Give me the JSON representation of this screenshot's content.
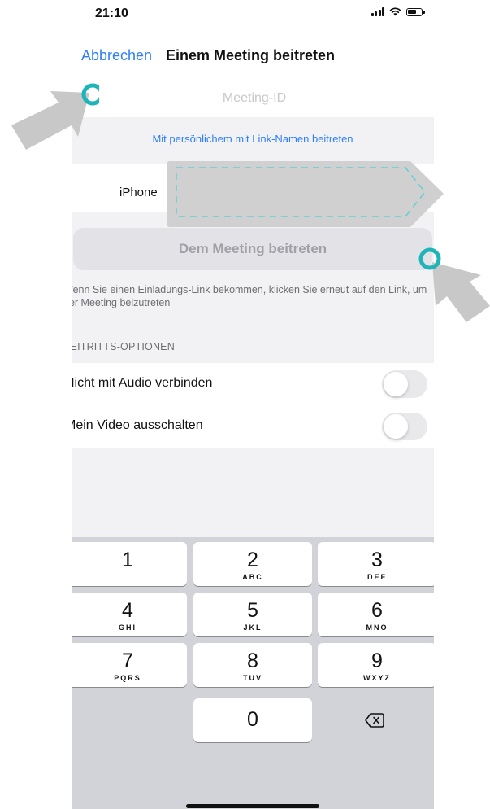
{
  "status_bar": {
    "time": "21:10"
  },
  "nav": {
    "cancel_label": "Abbrechen",
    "title": "Einem Meeting beitreten"
  },
  "meeting_id": {
    "placeholder": "Meeting-ID",
    "value": ""
  },
  "personal_link_label": "Mit persönlichem mit Link-Namen beitreten",
  "name_field": {
    "label": "iPhone",
    "value": ""
  },
  "join_button_label": "Dem Meeting beitreten",
  "hint": "Wenn Sie einen Einladungs-Link bekommen, klicken Sie erneut auf den Link, um der Meeting beizutreten",
  "join_options": {
    "header": "BEITRITTS-OPTIONEN",
    "items": [
      {
        "label": "Nicht mit Audio verbinden",
        "enabled": false
      },
      {
        "label": "Mein Video ausschalten",
        "enabled": false
      }
    ]
  },
  "keypad": {
    "keys": [
      {
        "digit": "1",
        "letters": ""
      },
      {
        "digit": "2",
        "letters": "ABC"
      },
      {
        "digit": "3",
        "letters": "DEF"
      },
      {
        "digit": "4",
        "letters": "GHI"
      },
      {
        "digit": "5",
        "letters": "JKL"
      },
      {
        "digit": "6",
        "letters": "MNO"
      },
      {
        "digit": "7",
        "letters": "PQRS"
      },
      {
        "digit": "8",
        "letters": "TUV"
      },
      {
        "digit": "9",
        "letters": "WXYZ"
      },
      {
        "digit": "0",
        "letters": ""
      }
    ],
    "delete_icon": "backspace-icon"
  },
  "colors": {
    "accent": "#2d7ff5",
    "highlight_ring": "#1fb5b8",
    "pointer_arrow": "#c8c8c8",
    "redaction": "#d0d0d0"
  }
}
